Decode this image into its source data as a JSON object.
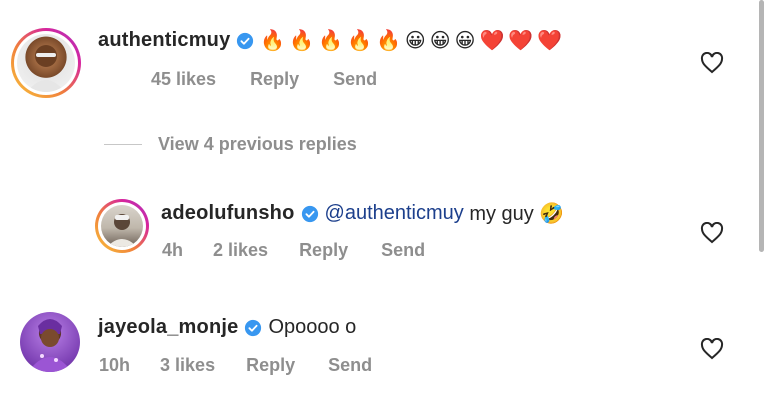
{
  "comments": [
    {
      "username": "authenticmuy",
      "text": "🔥🔥🔥🔥🔥😀😀😀❤️❤️❤️",
      "likes": "45 likes",
      "reply": "Reply",
      "send": "Send"
    },
    {
      "username": "adeolufunsho",
      "mention": "@authenticmuy",
      "text": " my guy 🤣",
      "time": "4h",
      "likes": "2 likes",
      "reply": "Reply",
      "send": "Send"
    },
    {
      "username": "jayeola_monje",
      "text": "Opoooo o",
      "time": "10h",
      "likes": "3 likes",
      "reply": "Reply",
      "send": "Send"
    }
  ],
  "view_replies": "View 4 previous replies",
  "colors": {
    "verified": "#3897f0",
    "muted": "#8e8e8e",
    "mention": "#1c3f8c"
  }
}
